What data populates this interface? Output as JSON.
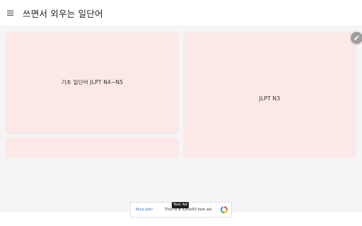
{
  "app": {
    "title": "쓰면서 외우는 일단어"
  },
  "toolbar": {
    "menu_icon": "hamburger-menu-icon"
  },
  "cards": [
    {
      "label": "기초 일단어 JLPT N4~N5"
    },
    {
      "label": "JLPT N3"
    },
    {
      "label": ""
    }
  ],
  "fab": {
    "icon": "pencil-icon"
  },
  "ad": {
    "badge": "Test Ad",
    "left_text": "Nice job!",
    "text": "This is a 320x50 test ad.",
    "logo_icon": "admob-logo-icon"
  },
  "colors": {
    "card_background": "#fce9e7",
    "page_background": "#f5f5f5",
    "fab": "#9e9e9e"
  }
}
